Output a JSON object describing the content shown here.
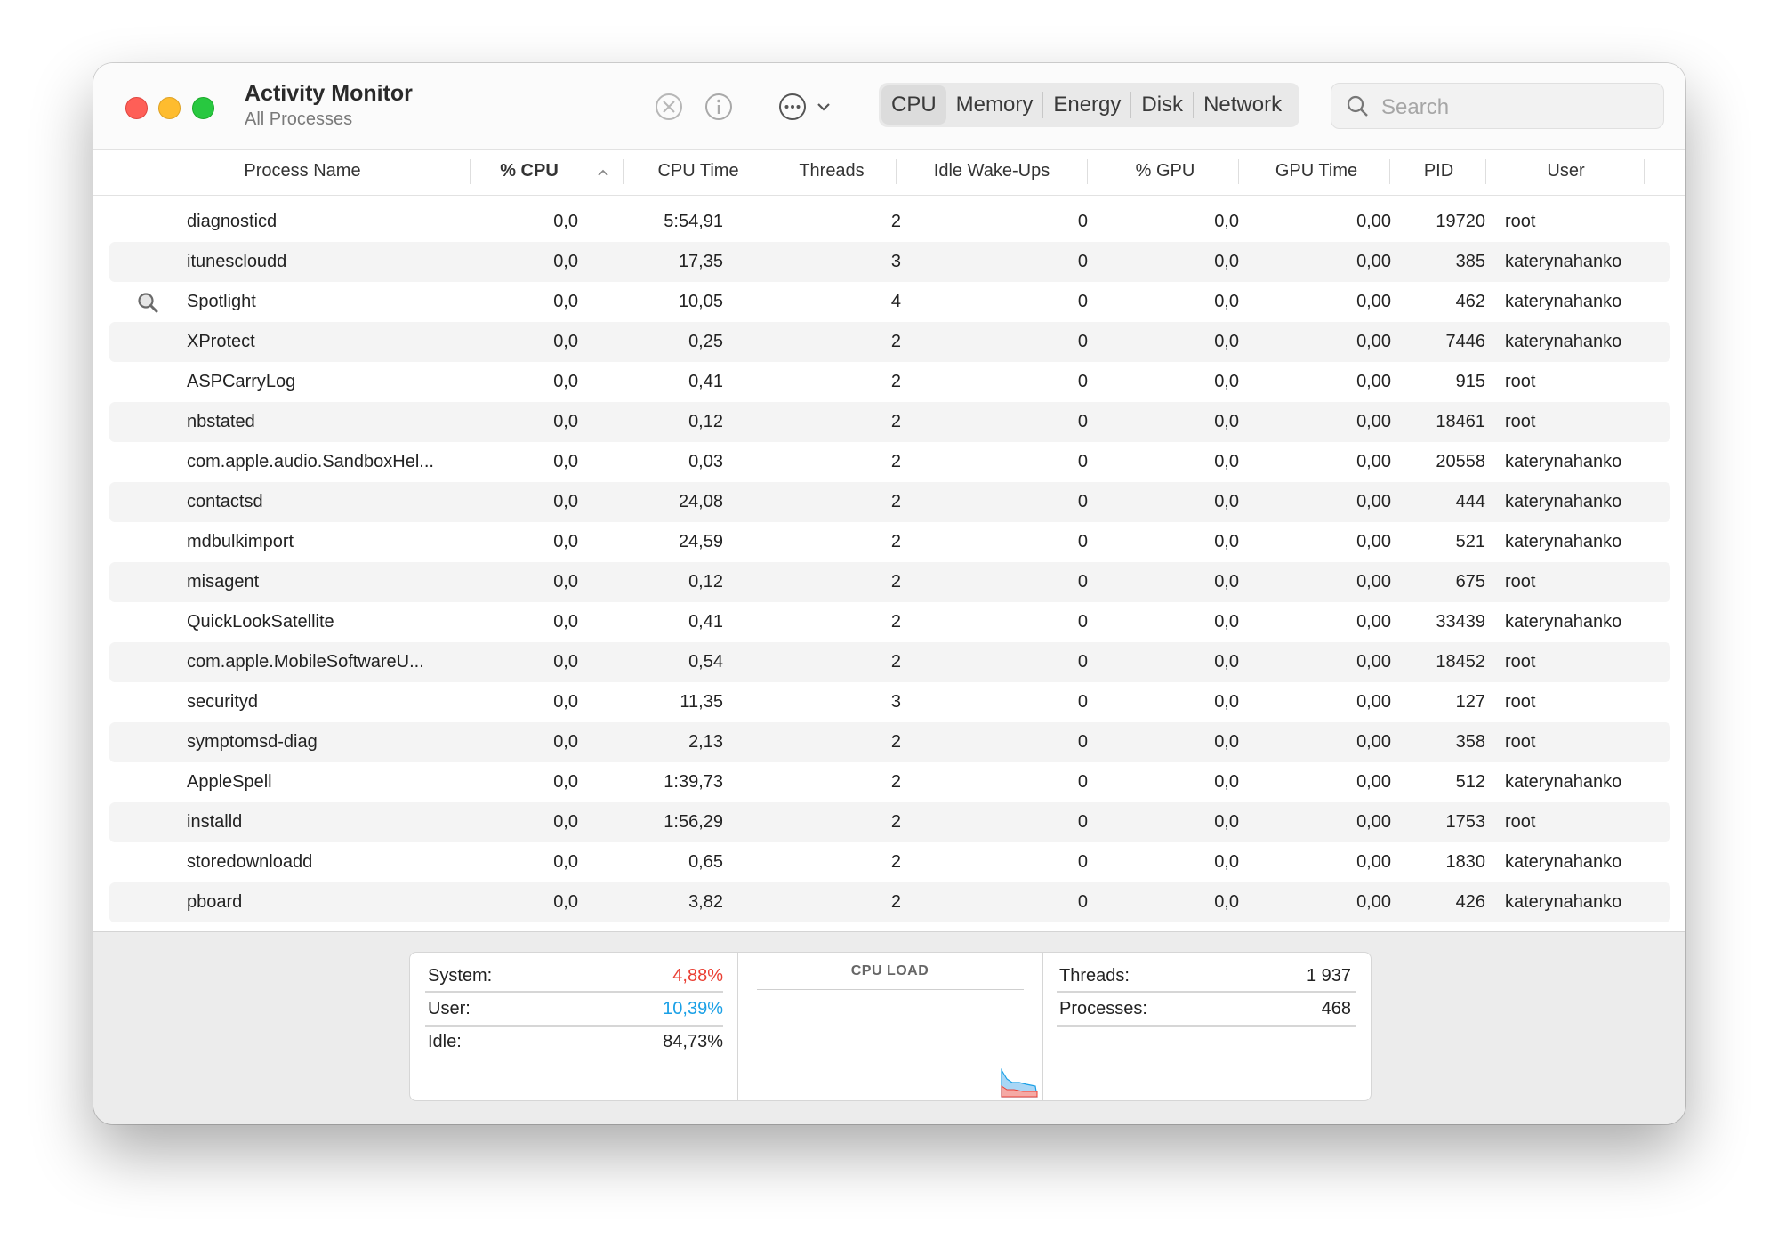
{
  "window": {
    "title": "Activity Monitor",
    "subtitle": "All Processes"
  },
  "toolbar": {
    "icons": [
      "stop-process-icon",
      "info-icon",
      "more-options-icon",
      "chevron-down-icon"
    ],
    "tabs": [
      {
        "label": "CPU",
        "active": true
      },
      {
        "label": "Memory",
        "active": false
      },
      {
        "label": "Energy",
        "active": false
      },
      {
        "label": "Disk",
        "active": false
      },
      {
        "label": "Network",
        "active": false
      }
    ],
    "search_placeholder": "Search"
  },
  "table": {
    "columns": [
      "Process Name",
      "% CPU",
      "CPU Time",
      "Threads",
      "Idle Wake-Ups",
      "% GPU",
      "GPU Time",
      "PID",
      "User"
    ],
    "sorted_column": "% CPU",
    "rows": [
      {
        "name": "diagnosticd",
        "cpu": "0,0",
        "cpu_time": "5:54,91",
        "threads": "2",
        "idle": "0",
        "gpu": "0,0",
        "gpu_time": "0,00",
        "pid": "19720",
        "user": "root"
      },
      {
        "name": "itunescloudd",
        "cpu": "0,0",
        "cpu_time": "17,35",
        "threads": "3",
        "idle": "0",
        "gpu": "0,0",
        "gpu_time": "0,00",
        "pid": "385",
        "user": "katerynahanko"
      },
      {
        "name": "Spotlight",
        "icon": "magnifier-icon",
        "cpu": "0,0",
        "cpu_time": "10,05",
        "threads": "4",
        "idle": "0",
        "gpu": "0,0",
        "gpu_time": "0,00",
        "pid": "462",
        "user": "katerynahanko"
      },
      {
        "name": "XProtect",
        "cpu": "0,0",
        "cpu_time": "0,25",
        "threads": "2",
        "idle": "0",
        "gpu": "0,0",
        "gpu_time": "0,00",
        "pid": "7446",
        "user": "katerynahanko"
      },
      {
        "name": "ASPCarryLog",
        "cpu": "0,0",
        "cpu_time": "0,41",
        "threads": "2",
        "idle": "0",
        "gpu": "0,0",
        "gpu_time": "0,00",
        "pid": "915",
        "user": "root"
      },
      {
        "name": "nbstated",
        "cpu": "0,0",
        "cpu_time": "0,12",
        "threads": "2",
        "idle": "0",
        "gpu": "0,0",
        "gpu_time": "0,00",
        "pid": "18461",
        "user": "root"
      },
      {
        "name": "com.apple.audio.SandboxHel...",
        "cpu": "0,0",
        "cpu_time": "0,03",
        "threads": "2",
        "idle": "0",
        "gpu": "0,0",
        "gpu_time": "0,00",
        "pid": "20558",
        "user": "katerynahanko"
      },
      {
        "name": "contactsd",
        "cpu": "0,0",
        "cpu_time": "24,08",
        "threads": "2",
        "idle": "0",
        "gpu": "0,0",
        "gpu_time": "0,00",
        "pid": "444",
        "user": "katerynahanko"
      },
      {
        "name": "mdbulkimport",
        "cpu": "0,0",
        "cpu_time": "24,59",
        "threads": "2",
        "idle": "0",
        "gpu": "0,0",
        "gpu_time": "0,00",
        "pid": "521",
        "user": "katerynahanko"
      },
      {
        "name": "misagent",
        "cpu": "0,0",
        "cpu_time": "0,12",
        "threads": "2",
        "idle": "0",
        "gpu": "0,0",
        "gpu_time": "0,00",
        "pid": "675",
        "user": "root"
      },
      {
        "name": "QuickLookSatellite",
        "cpu": "0,0",
        "cpu_time": "0,41",
        "threads": "2",
        "idle": "0",
        "gpu": "0,0",
        "gpu_time": "0,00",
        "pid": "33439",
        "user": "katerynahanko"
      },
      {
        "name": "com.apple.MobileSoftwareU...",
        "cpu": "0,0",
        "cpu_time": "0,54",
        "threads": "2",
        "idle": "0",
        "gpu": "0,0",
        "gpu_time": "0,00",
        "pid": "18452",
        "user": "root"
      },
      {
        "name": "securityd",
        "cpu": "0,0",
        "cpu_time": "11,35",
        "threads": "3",
        "idle": "0",
        "gpu": "0,0",
        "gpu_time": "0,00",
        "pid": "127",
        "user": "root"
      },
      {
        "name": "symptomsd-diag",
        "cpu": "0,0",
        "cpu_time": "2,13",
        "threads": "2",
        "idle": "0",
        "gpu": "0,0",
        "gpu_time": "0,00",
        "pid": "358",
        "user": "root"
      },
      {
        "name": "AppleSpell",
        "cpu": "0,0",
        "cpu_time": "1:39,73",
        "threads": "2",
        "idle": "0",
        "gpu": "0,0",
        "gpu_time": "0,00",
        "pid": "512",
        "user": "katerynahanko"
      },
      {
        "name": "installd",
        "cpu": "0,0",
        "cpu_time": "1:56,29",
        "threads": "2",
        "idle": "0",
        "gpu": "0,0",
        "gpu_time": "0,00",
        "pid": "1753",
        "user": "root"
      },
      {
        "name": "storedownloadd",
        "cpu": "0,0",
        "cpu_time": "0,65",
        "threads": "2",
        "idle": "0",
        "gpu": "0,0",
        "gpu_time": "0,00",
        "pid": "1830",
        "user": "katerynahanko"
      },
      {
        "name": "pboard",
        "cpu": "0,0",
        "cpu_time": "3,82",
        "threads": "2",
        "idle": "0",
        "gpu": "0,0",
        "gpu_time": "0,00",
        "pid": "426",
        "user": "katerynahanko"
      }
    ]
  },
  "summary": {
    "system_label": "System:",
    "system_value": "4,88%",
    "user_label": "User:",
    "user_value": "10,39%",
    "idle_label": "Idle:",
    "idle_value": "84,73%",
    "cpu_load_label": "CPU LOAD",
    "threads_label": "Threads:",
    "threads_value": "1 937",
    "processes_label": "Processes:",
    "processes_value": "468",
    "colors": {
      "system": "#ea3f33",
      "user": "#1aa0e6"
    }
  }
}
